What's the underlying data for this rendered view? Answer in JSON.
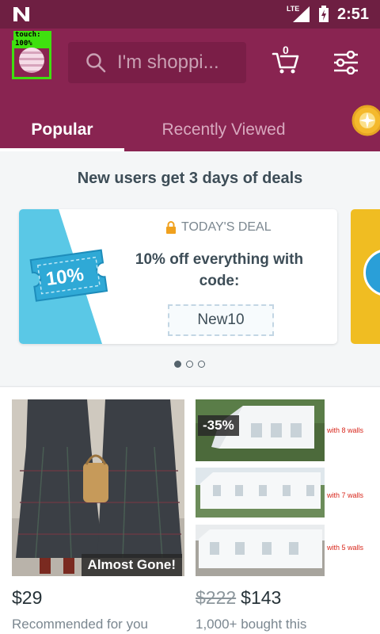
{
  "status_bar": {
    "network": "LTE",
    "time": "2:51"
  },
  "debug_overlay": {
    "touch_label": "touch: 100%"
  },
  "search": {
    "placeholder": "I'm shoppi..."
  },
  "cart": {
    "count": "0"
  },
  "tabs": [
    {
      "label": "Popular",
      "selected": true
    },
    {
      "label": "Recently Viewed",
      "selected": false
    }
  ],
  "deals": {
    "headline": "New users get 3 days of deals",
    "card": {
      "coupon_text": "10%",
      "kicker": "TODAY'S DEAL",
      "description": "10% off everything with code:",
      "code": "New10"
    },
    "pager": {
      "count": 3,
      "active_index": 0
    }
  },
  "products": [
    {
      "badge": "Almost Gone!",
      "price": "$29",
      "subtitle": "Recommended for you"
    },
    {
      "discount_badge": "-35%",
      "tent_labels": [
        "with 8 walls",
        "with 7 walls",
        "with 5 walls"
      ],
      "old_price": "$222",
      "price": "$143",
      "subtitle": "1,000+ bought this"
    }
  ],
  "colors": {
    "status_bar": "#6e1f42",
    "app_bar": "#892451",
    "accent_lock": "#f0a11e",
    "coupon": "#38b6dc",
    "debug_frame": "#3fe00f"
  }
}
